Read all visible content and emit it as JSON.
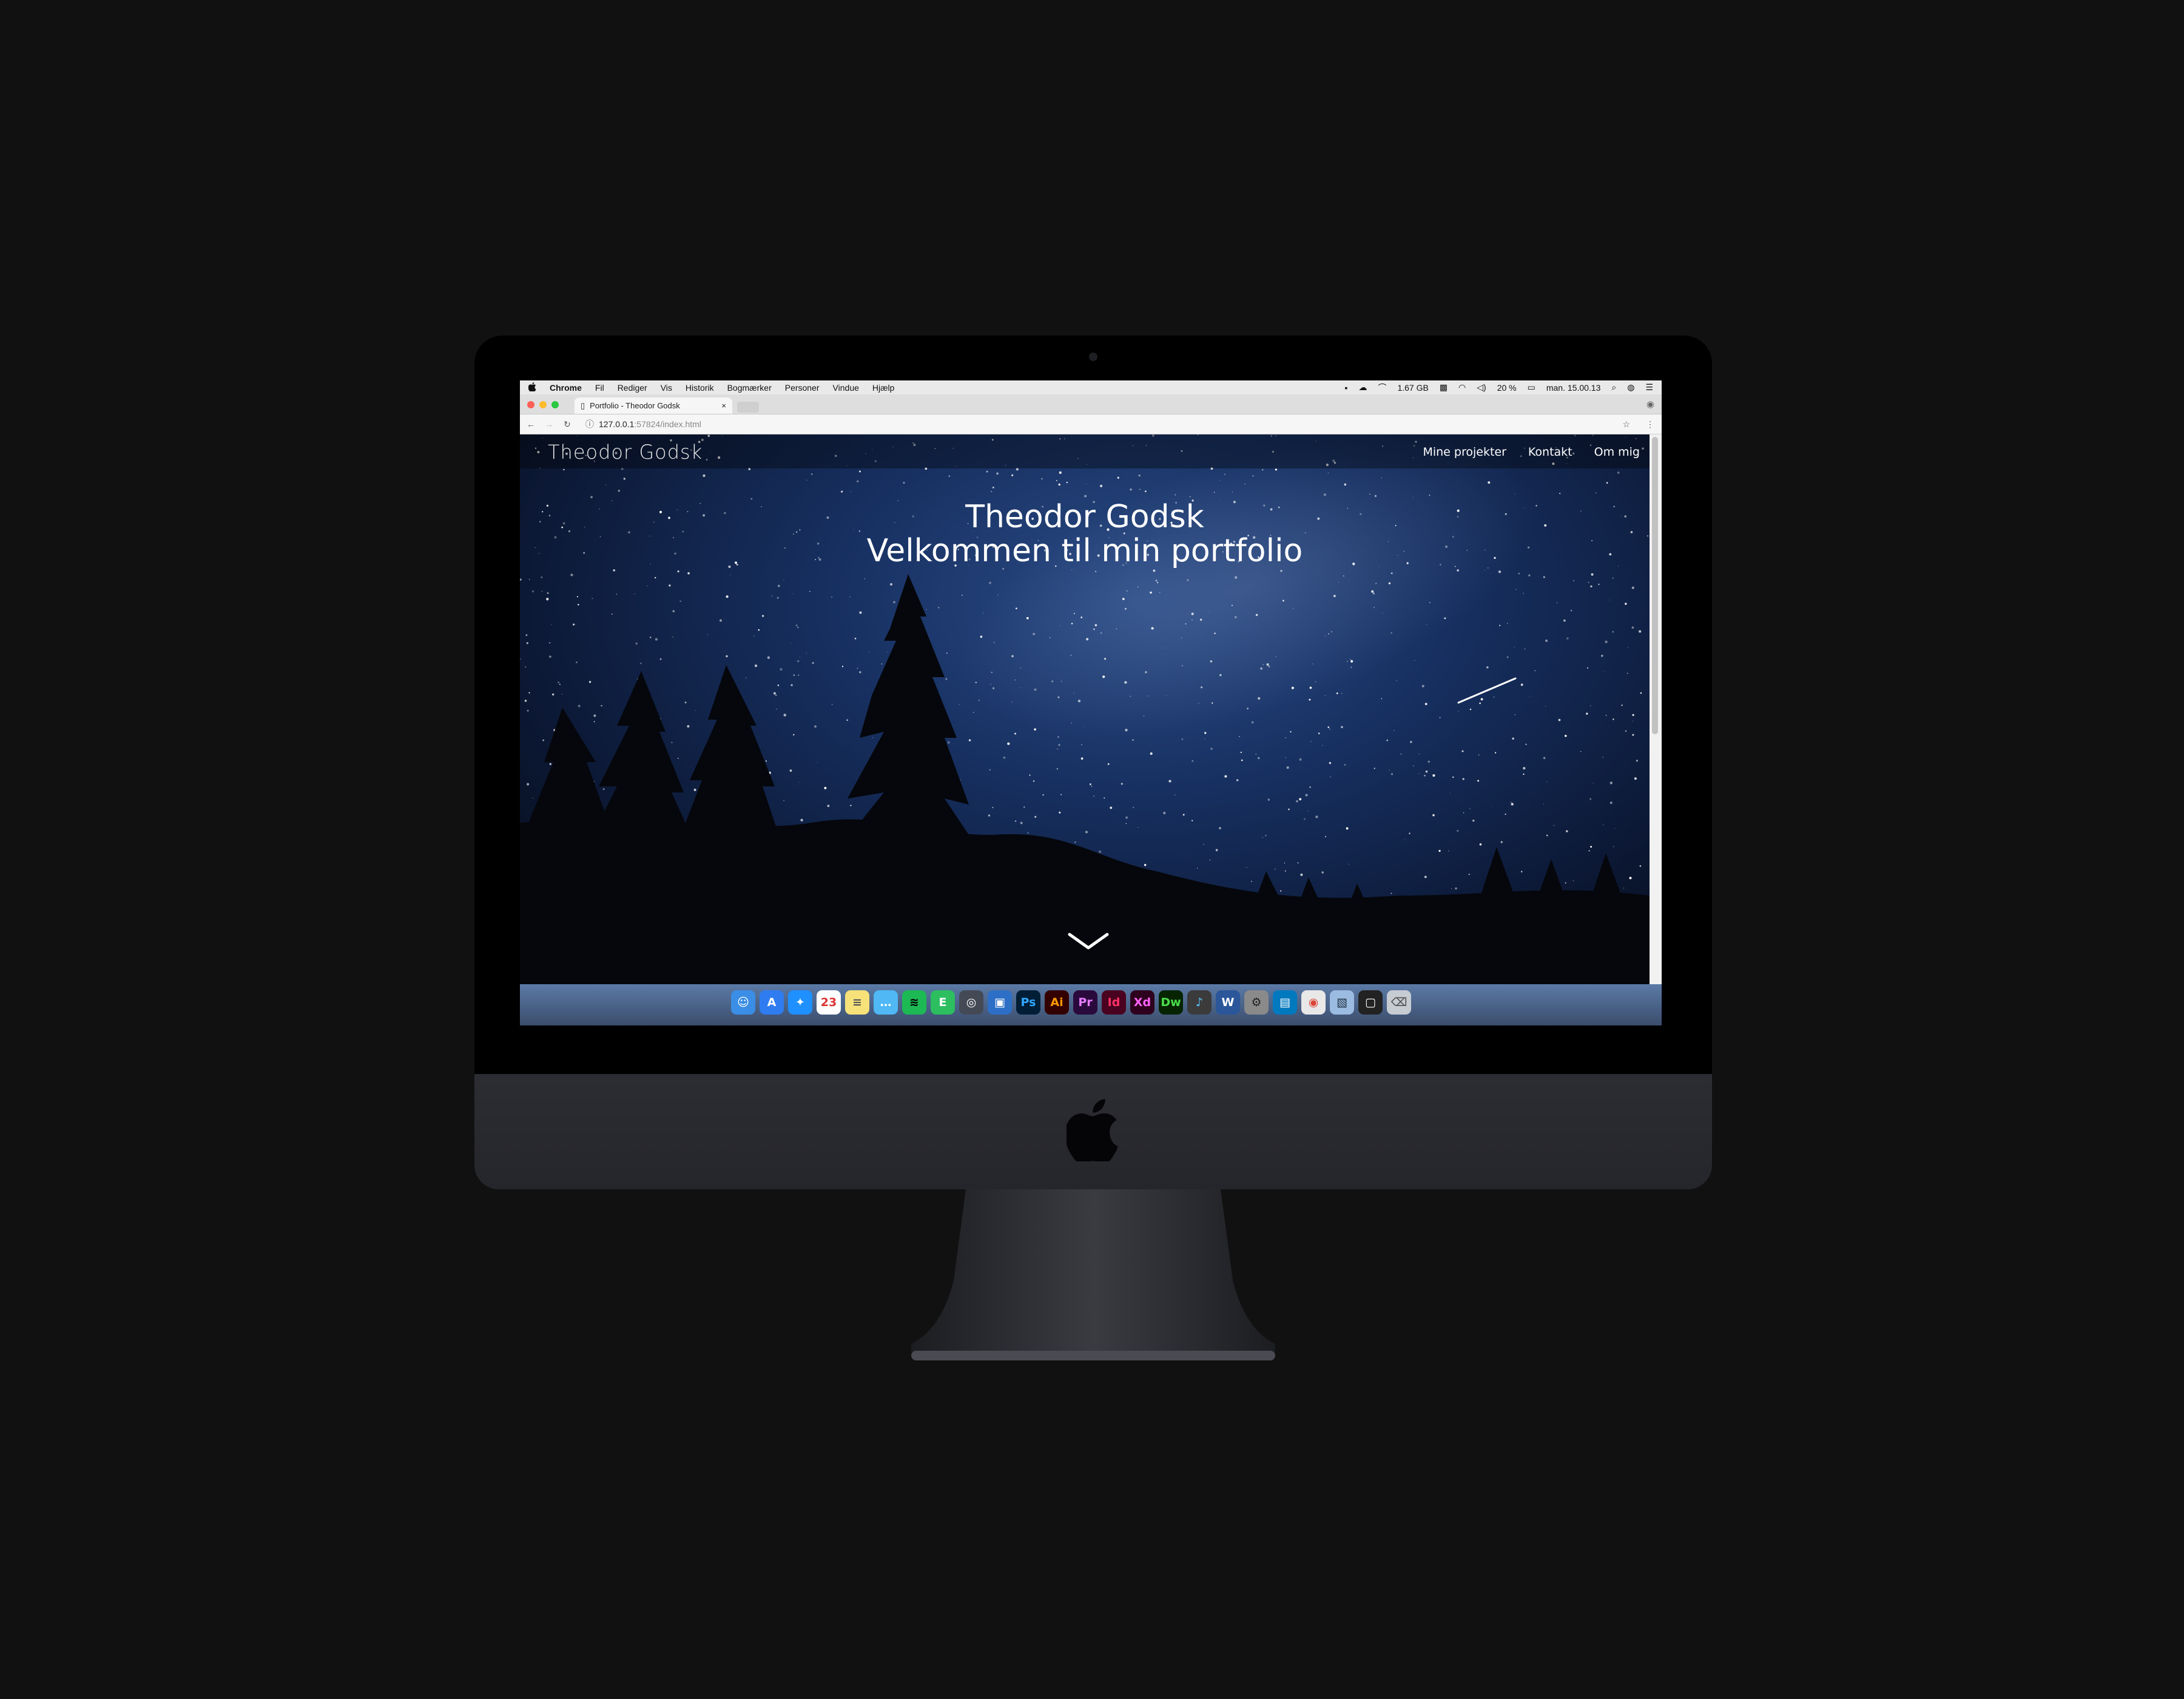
{
  "menubar": {
    "apple": "",
    "app": "Chrome",
    "menus": [
      "Fil",
      "Rediger",
      "Vis",
      "Historik",
      "Bogmærker",
      "Personer",
      "Vindue",
      "Hjælp"
    ],
    "memory": "1.67 GB",
    "battery": "20 %",
    "clock": "man. 15.00.13"
  },
  "browser": {
    "tab_title": "Portfolio - Theodor Godsk",
    "tab_close": "×",
    "url_host": "127.0.0.1",
    "url_path": ":57824/index.html"
  },
  "site": {
    "brand": "Theodor Godsk",
    "nav": [
      "Mine projekter",
      "Kontakt",
      "Om mig"
    ],
    "hero_title": "Theodor Godsk",
    "hero_subtitle": "Velkommen til min portfolio"
  },
  "dock": {
    "apps": [
      {
        "name": "finder",
        "label": "☺",
        "bg": "#3a8ee6",
        "fg": "#fff"
      },
      {
        "name": "appstore",
        "label": "A",
        "bg": "#2f7cf0",
        "fg": "#fff"
      },
      {
        "name": "safari",
        "label": "✦",
        "bg": "#1e90ff",
        "fg": "#fff"
      },
      {
        "name": "calendar",
        "label": "23",
        "bg": "#ffffff",
        "fg": "#d33"
      },
      {
        "name": "notes",
        "label": "≡",
        "bg": "#f7e27a",
        "fg": "#555"
      },
      {
        "name": "messages",
        "label": "…",
        "bg": "#4fb8f5",
        "fg": "#fff"
      },
      {
        "name": "spotify",
        "label": "≋",
        "bg": "#1db954",
        "fg": "#000"
      },
      {
        "name": "evernote",
        "label": "E",
        "bg": "#2dbe60",
        "fg": "#fff"
      },
      {
        "name": "launchpad",
        "label": "◎",
        "bg": "#444a55",
        "fg": "#fff"
      },
      {
        "name": "screenshot",
        "label": "▣",
        "bg": "#2d6fc6",
        "fg": "#fff"
      },
      {
        "name": "photoshop",
        "label": "Ps",
        "bg": "#001e36",
        "fg": "#31a8ff"
      },
      {
        "name": "illustrator",
        "label": "Ai",
        "bg": "#330000",
        "fg": "#ff9a00"
      },
      {
        "name": "premiere",
        "label": "Pr",
        "bg": "#2a0a3d",
        "fg": "#e77cff"
      },
      {
        "name": "indesign",
        "label": "Id",
        "bg": "#49021f",
        "fg": "#ff3366"
      },
      {
        "name": "xd",
        "label": "Xd",
        "bg": "#2e001e",
        "fg": "#ff61f6"
      },
      {
        "name": "dreamweaver",
        "label": "Dw",
        "bg": "#072401",
        "fg": "#4bde4b"
      },
      {
        "name": "itunes",
        "label": "♪",
        "bg": "#3b3b3b",
        "fg": "#5cc6ff"
      },
      {
        "name": "word",
        "label": "W",
        "bg": "#2b579a",
        "fg": "#fff"
      },
      {
        "name": "preferences",
        "label": "⚙",
        "bg": "#8a8a8a",
        "fg": "#222"
      },
      {
        "name": "trello",
        "label": "▤",
        "bg": "#0079bf",
        "fg": "#fff"
      },
      {
        "name": "chrome",
        "label": "◉",
        "bg": "#e8e8e8",
        "fg": "#db4437"
      },
      {
        "name": "preview",
        "label": "▧",
        "bg": "#9bbbe0",
        "fg": "#234"
      },
      {
        "name": "downloads",
        "label": "▢",
        "bg": "#222",
        "fg": "#fff"
      },
      {
        "name": "trash",
        "label": "⌫",
        "bg": "#c7ccd3",
        "fg": "#555"
      }
    ]
  },
  "colors": {
    "sky": "#173061",
    "text": "#ffffff"
  }
}
